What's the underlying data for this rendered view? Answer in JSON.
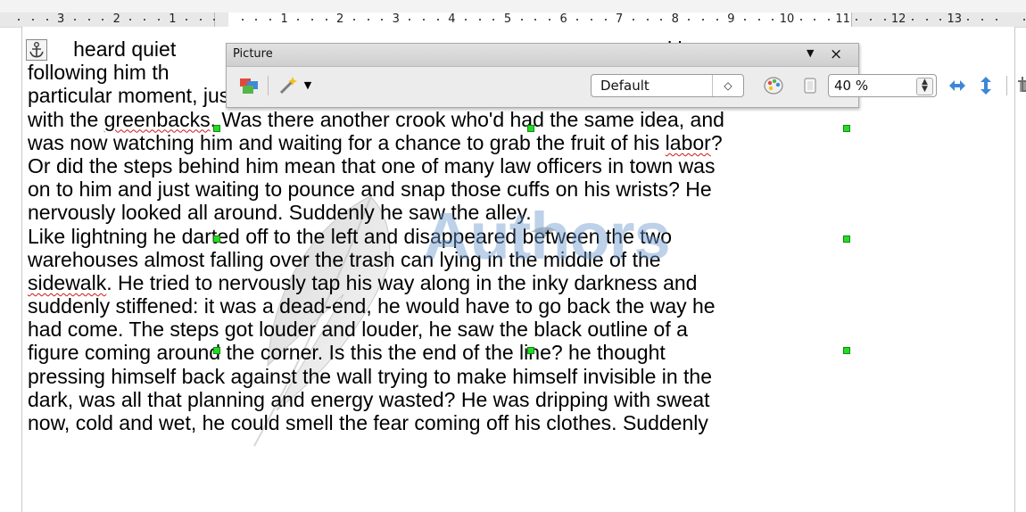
{
  "ruler": {
    "left_numbers": [
      "3",
      "2",
      "1"
    ],
    "right_numbers": [
      "1",
      "2",
      "3",
      "4",
      "5",
      "6",
      "7",
      "8",
      "9",
      "10",
      "11",
      "12",
      "13"
    ]
  },
  "toolbar": {
    "title": "Picture",
    "close_glyph": "×",
    "menu_glyph": "▼",
    "graphics_mode": "Default",
    "transparency": "40 %",
    "icons": [
      "image-filter-icon",
      "magic-wand-icon",
      "color-icon",
      "transparency-icon",
      "flip-vertical-icon",
      "flip-horizontal-icon",
      "crop-icon"
    ]
  },
  "watermark": {
    "text": "Authors",
    "brand_color": "#6f9ad0"
  },
  "document": {
    "lines": [
      {
        "segments": [
          {
            "text": "        heard quiet                                                                                     d be"
          }
        ]
      },
      {
        "segments": [
          {
            "text": "following him th                                                                                 And at this"
          }
        ]
      },
      {
        "segments": [
          {
            "text": "particular moment, just after he pulled off the big time and was making off"
          }
        ]
      },
      {
        "segments": [
          {
            "text": "with the "
          },
          {
            "text": "greenbacks",
            "spell": true
          },
          {
            "text": ". Was there another crook who'd had the same idea, and"
          }
        ]
      },
      {
        "segments": [
          {
            "text": "was now watching him and waiting for a chance to grab the fruit of his "
          },
          {
            "text": "labor",
            "spell": true
          },
          {
            "text": "?"
          }
        ]
      },
      {
        "segments": [
          {
            "text": "Or did the steps behind him mean that one of many law officers in town was"
          }
        ]
      },
      {
        "segments": [
          {
            "text": "on to him and just waiting to pounce and snap those cuffs on his wrists? He"
          }
        ]
      },
      {
        "segments": [
          {
            "text": "nervously looked all around. Suddenly he saw the alley."
          }
        ]
      },
      {
        "segments": [
          {
            "text": "Like lightning he darted off to the left and disappeared between the two"
          }
        ]
      },
      {
        "segments": [
          {
            "text": "warehouses almost falling over the trash can lying in the middle of the"
          }
        ]
      },
      {
        "segments": [
          {
            "text": "sidewalk",
            "spell": true
          },
          {
            "text": ". He tried to nervously tap his way along in the inky darkness and"
          }
        ]
      },
      {
        "segments": [
          {
            "text": "suddenly stiffened: it was a dead-end, he would have to go back the way he"
          }
        ]
      },
      {
        "segments": [
          {
            "text": "had come. The steps got louder and louder, he saw the black outline of a"
          }
        ]
      },
      {
        "segments": [
          {
            "text": "figure coming around the corner. Is this the end of the line? he thought"
          }
        ]
      },
      {
        "segments": [
          {
            "text": "pressing himself back against the wall trying to make himself invisible in the"
          }
        ]
      },
      {
        "segments": [
          {
            "text": "dark, was all that planning and energy wasted? He was dripping with sweat"
          }
        ]
      },
      {
        "segments": [
          {
            "text": "now, cold and wet, he could smell the fear coming off his clothes. Suddenly"
          }
        ]
      }
    ]
  }
}
